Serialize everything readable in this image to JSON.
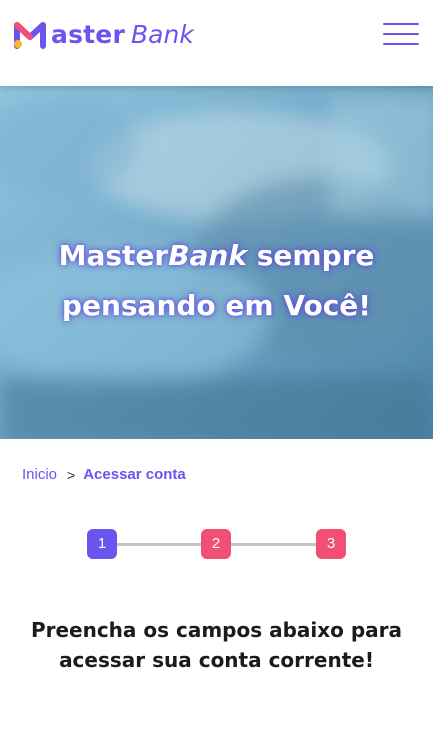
{
  "header": {
    "logo_text_primary": "aster",
    "logo_text_secondary": "Bank",
    "menu_icon": "hamburger-menu-icon",
    "colors": {
      "brand": "#6a55f1",
      "accent": "#f14f75",
      "accent_yellow": "#f5b82e"
    }
  },
  "hero": {
    "title_part1": "Master",
    "title_part2": "Bank",
    "title_part3": " sempre",
    "title_line2": "pensando em Você!"
  },
  "breadcrumb": {
    "home": "Inicio",
    "separator": ">",
    "current": "Acessar conta"
  },
  "steps": [
    {
      "label": "1",
      "state": "active"
    },
    {
      "label": "2",
      "state": "pending"
    },
    {
      "label": "3",
      "state": "pending"
    }
  ],
  "main": {
    "intro_text": "Preencha os campos abaixo para acessar sua conta corrente!"
  }
}
